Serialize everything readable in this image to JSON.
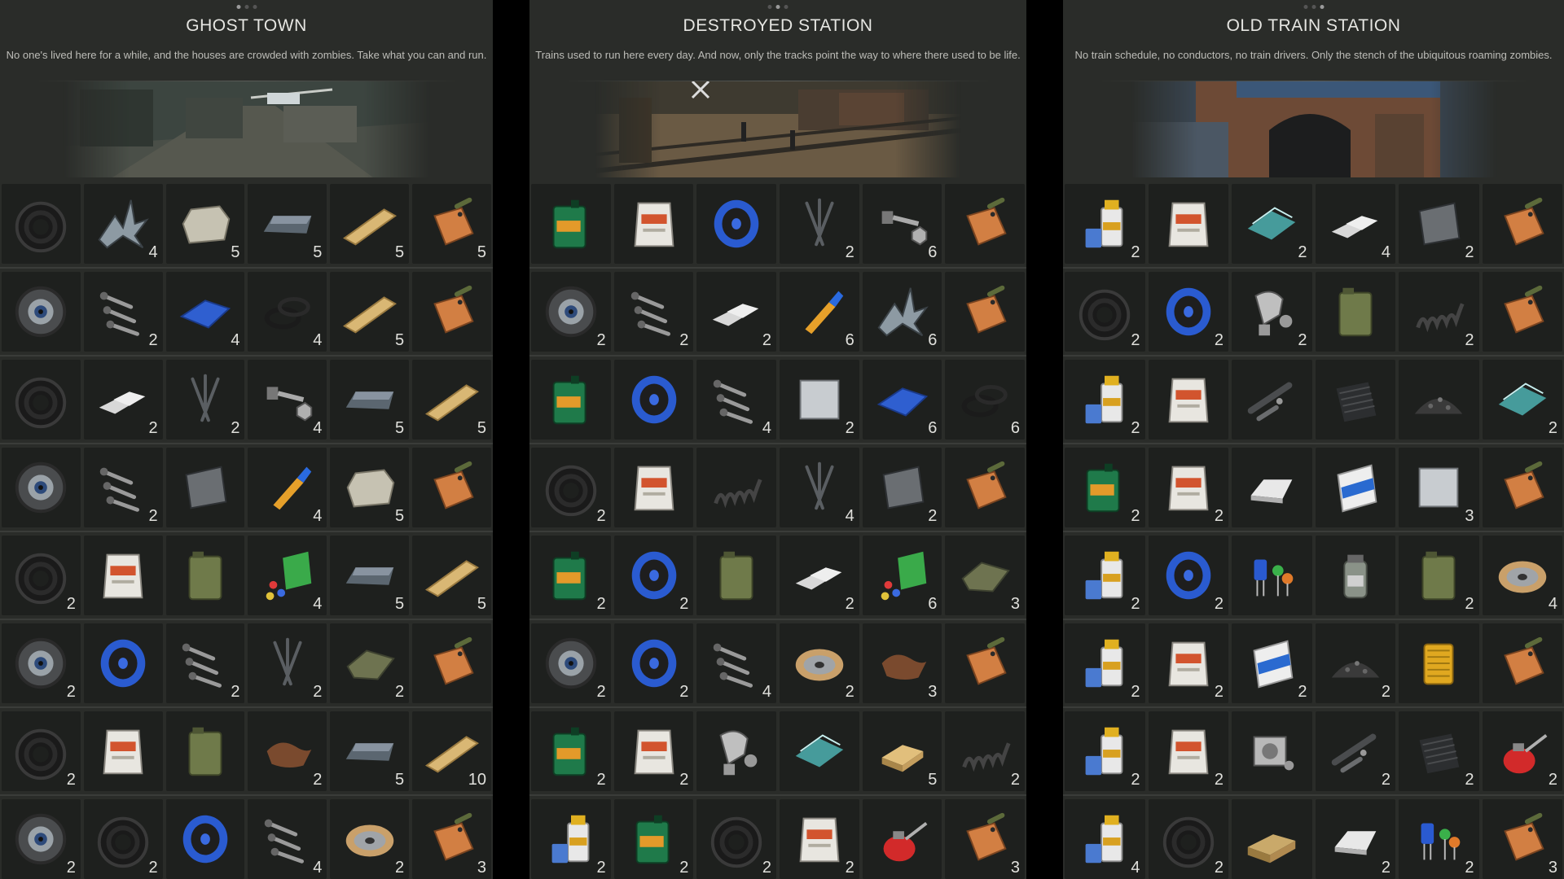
{
  "panels": [
    {
      "title": "GHOST TOWN",
      "description": "No one's lived here for a while, and the houses are crowded with zombies. Take what you can and run.",
      "rows": [
        [
          {
            "icon": "tire-icon",
            "count": ""
          },
          {
            "icon": "scrap-metal-icon",
            "count": "4"
          },
          {
            "icon": "stone-icon",
            "count": "5"
          },
          {
            "icon": "iron-ingot-icon",
            "count": "5"
          },
          {
            "icon": "wood-plank-icon",
            "count": "5"
          },
          {
            "icon": "ammo-tag-icon",
            "count": "5"
          }
        ],
        [
          {
            "icon": "wheel-icon",
            "count": ""
          },
          {
            "icon": "screws-icon",
            "count": "2"
          },
          {
            "icon": "blue-tape-icon",
            "count": "4"
          },
          {
            "icon": "rubber-rings-icon",
            "count": "4"
          },
          {
            "icon": "wood-plank-icon",
            "count": "5"
          },
          {
            "icon": "ammo-tag-icon",
            "count": ""
          }
        ],
        [
          {
            "icon": "tire-icon",
            "count": ""
          },
          {
            "icon": "aluminum-bars-icon",
            "count": "2"
          },
          {
            "icon": "nails-icon",
            "count": "2"
          },
          {
            "icon": "bolt-nut-icon",
            "count": "4"
          },
          {
            "icon": "iron-ingot-icon",
            "count": "5"
          },
          {
            "icon": "wood-plank-icon",
            "count": "5"
          }
        ],
        [
          {
            "icon": "wheel-icon",
            "count": ""
          },
          {
            "icon": "screws-icon",
            "count": "2"
          },
          {
            "icon": "steel-plate-icon",
            "count": ""
          },
          {
            "icon": "glue-icon",
            "count": "4"
          },
          {
            "icon": "stone-icon",
            "count": "5"
          },
          {
            "icon": "ammo-tag-icon",
            "count": ""
          }
        ],
        [
          {
            "icon": "tire-icon",
            "count": "2"
          },
          {
            "icon": "asbestos-bag-icon",
            "count": ""
          },
          {
            "icon": "jerrycan-icon",
            "count": ""
          },
          {
            "icon": "plastic-parts-icon",
            "count": "4"
          },
          {
            "icon": "iron-ingot-icon",
            "count": "5"
          },
          {
            "icon": "wood-plank-icon",
            "count": "5"
          }
        ],
        [
          {
            "icon": "wheel-icon",
            "count": "2"
          },
          {
            "icon": "wire-spool-icon",
            "count": ""
          },
          {
            "icon": "screws-icon",
            "count": "2"
          },
          {
            "icon": "nails-icon",
            "count": "2"
          },
          {
            "icon": "cloth-icon",
            "count": "2"
          },
          {
            "icon": "ammo-tag-icon",
            "count": ""
          }
        ],
        [
          {
            "icon": "tire-icon",
            "count": "2"
          },
          {
            "icon": "asbestos-bag-icon",
            "count": ""
          },
          {
            "icon": "jerrycan-icon",
            "count": ""
          },
          {
            "icon": "leather-icon",
            "count": "2"
          },
          {
            "icon": "iron-ingot-icon",
            "count": "5"
          },
          {
            "icon": "wood-plank-icon",
            "count": "10"
          }
        ],
        [
          {
            "icon": "wheel-icon",
            "count": "2"
          },
          {
            "icon": "tire-icon",
            "count": "2"
          },
          {
            "icon": "wire-spool-icon",
            "count": ""
          },
          {
            "icon": "screws-icon",
            "count": "4"
          },
          {
            "icon": "copper-spool-icon",
            "count": "2"
          },
          {
            "icon": "ammo-tag-icon",
            "count": "3"
          }
        ]
      ]
    },
    {
      "title": "DESTROYED STATION",
      "description": "Trains used to run here every day. And now, only the tracks point the way to where there used to be life.",
      "rows": [
        [
          {
            "icon": "motor-oil-icon",
            "count": ""
          },
          {
            "icon": "asbestos-bag-icon",
            "count": ""
          },
          {
            "icon": "wire-spool-icon",
            "count": ""
          },
          {
            "icon": "nails-icon",
            "count": "2"
          },
          {
            "icon": "bolt-nut-icon",
            "count": "6"
          },
          {
            "icon": "ammo-tag-icon",
            "count": ""
          }
        ],
        [
          {
            "icon": "wheel-icon",
            "count": "2"
          },
          {
            "icon": "screws-icon",
            "count": "2"
          },
          {
            "icon": "aluminum-bars-icon",
            "count": "2"
          },
          {
            "icon": "glue-icon",
            "count": "6"
          },
          {
            "icon": "scrap-metal-icon",
            "count": "6"
          },
          {
            "icon": "ammo-tag-icon",
            "count": ""
          }
        ],
        [
          {
            "icon": "motor-oil-icon",
            "count": ""
          },
          {
            "icon": "wire-spool-icon",
            "count": ""
          },
          {
            "icon": "screws-icon",
            "count": "4"
          },
          {
            "icon": "sheet-metal-icon",
            "count": "2"
          },
          {
            "icon": "blue-tape-icon",
            "count": "6"
          },
          {
            "icon": "rubber-rings-icon",
            "count": "6"
          }
        ],
        [
          {
            "icon": "tire-icon",
            "count": "2"
          },
          {
            "icon": "asbestos-bag-icon",
            "count": ""
          },
          {
            "icon": "spring-icon",
            "count": ""
          },
          {
            "icon": "nails-icon",
            "count": "4"
          },
          {
            "icon": "steel-plate-icon",
            "count": "2"
          },
          {
            "icon": "ammo-tag-icon",
            "count": ""
          }
        ],
        [
          {
            "icon": "motor-oil-icon",
            "count": "2"
          },
          {
            "icon": "wire-spool-icon",
            "count": "2"
          },
          {
            "icon": "jerrycan-icon",
            "count": ""
          },
          {
            "icon": "aluminum-bars-icon",
            "count": "2"
          },
          {
            "icon": "plastic-parts-icon",
            "count": "6"
          },
          {
            "icon": "cloth-icon",
            "count": "3"
          }
        ],
        [
          {
            "icon": "wheel-icon",
            "count": "2"
          },
          {
            "icon": "wire-spool-icon",
            "count": "2"
          },
          {
            "icon": "screws-icon",
            "count": "4"
          },
          {
            "icon": "copper-spool-icon",
            "count": "2"
          },
          {
            "icon": "leather-icon",
            "count": "3"
          },
          {
            "icon": "ammo-tag-icon",
            "count": ""
          }
        ],
        [
          {
            "icon": "motor-oil-icon",
            "count": "2"
          },
          {
            "icon": "asbestos-bag-icon",
            "count": "2"
          },
          {
            "icon": "engine-part-icon",
            "count": ""
          },
          {
            "icon": "glass-icon",
            "count": ""
          },
          {
            "icon": "wood-block-icon",
            "count": "5"
          },
          {
            "icon": "spring-icon",
            "count": "2"
          }
        ],
        [
          {
            "icon": "resin-icon",
            "count": "2"
          },
          {
            "icon": "motor-oil-icon",
            "count": "2"
          },
          {
            "icon": "tire-icon",
            "count": "2"
          },
          {
            "icon": "asbestos-bag-icon",
            "count": "2"
          },
          {
            "icon": "oil-can-icon",
            "count": ""
          },
          {
            "icon": "ammo-tag-icon",
            "count": "3"
          }
        ]
      ]
    },
    {
      "title": "OLD TRAIN STATION",
      "description": "No train schedule, no conductors, no train drivers. Only the stench of the ubiquitous roaming zombies.",
      "rows": [
        [
          {
            "icon": "resin-icon",
            "count": "2"
          },
          {
            "icon": "asbestos-bag-icon",
            "count": ""
          },
          {
            "icon": "glass-icon",
            "count": "2"
          },
          {
            "icon": "aluminum-bars-icon",
            "count": "4"
          },
          {
            "icon": "steel-plate-icon",
            "count": "2"
          },
          {
            "icon": "ammo-tag-icon",
            "count": ""
          }
        ],
        [
          {
            "icon": "tire-icon",
            "count": "2"
          },
          {
            "icon": "wire-spool-icon",
            "count": "2"
          },
          {
            "icon": "engine-part-icon",
            "count": "2"
          },
          {
            "icon": "jerrycan-icon",
            "count": ""
          },
          {
            "icon": "spring-icon",
            "count": "2"
          },
          {
            "icon": "ammo-tag-icon",
            "count": ""
          }
        ],
        [
          {
            "icon": "resin-icon",
            "count": "2"
          },
          {
            "icon": "asbestos-bag-icon",
            "count": ""
          },
          {
            "icon": "pipe-icon",
            "count": ""
          },
          {
            "icon": "rubber-sheet-icon",
            "count": ""
          },
          {
            "icon": "gravel-icon",
            "count": ""
          },
          {
            "icon": "glass-icon",
            "count": "2"
          }
        ],
        [
          {
            "icon": "motor-oil-icon",
            "count": "2"
          },
          {
            "icon": "asbestos-bag-icon",
            "count": "2"
          },
          {
            "icon": "silver-ingot-icon",
            "count": ""
          },
          {
            "icon": "cement-bag-icon",
            "count": ""
          },
          {
            "icon": "sheet-metal-icon",
            "count": "3"
          },
          {
            "icon": "ammo-tag-icon",
            "count": ""
          }
        ],
        [
          {
            "icon": "resin-icon",
            "count": "2"
          },
          {
            "icon": "wire-spool-icon",
            "count": "2"
          },
          {
            "icon": "electronics-icon",
            "count": ""
          },
          {
            "icon": "chemical-jar-icon",
            "count": ""
          },
          {
            "icon": "jerrycan-icon",
            "count": "2"
          },
          {
            "icon": "copper-spool-icon",
            "count": "4"
          }
        ],
        [
          {
            "icon": "resin-icon",
            "count": "2"
          },
          {
            "icon": "asbestos-bag-icon",
            "count": "2"
          },
          {
            "icon": "cement-bag-icon",
            "count": "2"
          },
          {
            "icon": "gravel-icon",
            "count": "2"
          },
          {
            "icon": "filter-icon",
            "count": ""
          },
          {
            "icon": "ammo-tag-icon",
            "count": ""
          }
        ],
        [
          {
            "icon": "resin-icon",
            "count": "2"
          },
          {
            "icon": "asbestos-bag-icon",
            "count": "2"
          },
          {
            "icon": "engine-block-icon",
            "count": ""
          },
          {
            "icon": "pipe-icon",
            "count": "2"
          },
          {
            "icon": "rubber-sheet-icon",
            "count": "2"
          },
          {
            "icon": "oil-can-icon",
            "count": "2"
          }
        ],
        [
          {
            "icon": "resin-icon",
            "count": "4"
          },
          {
            "icon": "tire-icon",
            "count": "2"
          },
          {
            "icon": "wood-crate-icon",
            "count": ""
          },
          {
            "icon": "silver-ingot-icon",
            "count": "2"
          },
          {
            "icon": "electronics-icon",
            "count": "2"
          },
          {
            "icon": "ammo-tag-icon",
            "count": "3"
          }
        ]
      ]
    }
  ],
  "colors": {
    "panel_bg": "#2a2c29",
    "slot_bg": "#1e201e",
    "title": "#e6e6e2",
    "text": "#bdbdb8"
  }
}
